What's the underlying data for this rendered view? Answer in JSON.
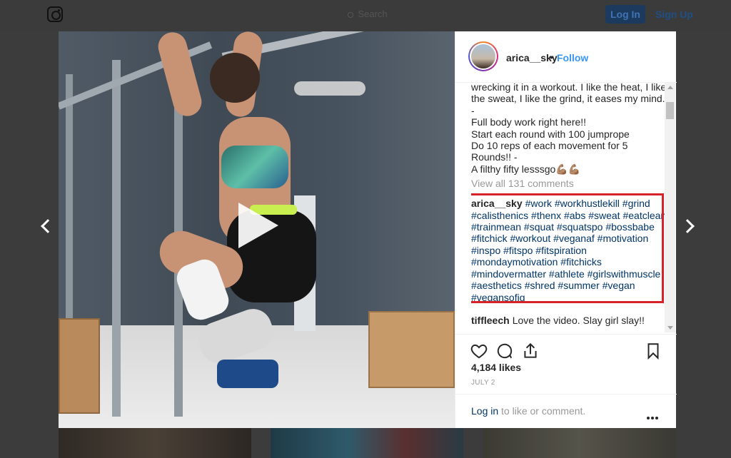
{
  "nav": {
    "search_placeholder": "Search",
    "login_label": "Log In",
    "signup_label": "Sign Up"
  },
  "post": {
    "username": "arica__sky",
    "separator": "•",
    "follow_label": "Follow",
    "caption_lines": "wrecking it in a workout. I like the heat, I like the sweat, I like the grind, it eases my mind.\n-\nFull body work right here!!\nStart each round with 100 jumprope\nDo 10 reps of each movement for 5 Rounds!! -\nA filthy fifty lesssgo💪🏽💪🏽",
    "view_all_comments": "View all 131 comments",
    "hashtag_comment": {
      "author": "arica__sky",
      "tags": "#work #workhustlekill #grind #calisthenics #thenx #abs #sweat #eatclean #trainmean #squat #squatspo #bossbabe #fitchick #workout #veganaf #motivation #inspo #fitspo #fitspiration #mondaymotivation #fitchicks #mindovermatter #athlete #girlswithmuscle #aesthetics #shred #summer #vegan #vegansofig"
    },
    "comment2": {
      "author": "tiffleech",
      "text": "Love the video. Slay girl slay!!"
    },
    "likes": "4,184 likes",
    "date": "JULY 2",
    "login_link": "Log in",
    "login_rest": "to like or comment."
  },
  "icons": {
    "heart": "heart-icon",
    "comment": "comment-icon",
    "share": "share-icon",
    "save": "bookmark-icon",
    "more": "more-options-icon",
    "play": "play-icon"
  },
  "colors": {
    "link": "#003569",
    "follow": "#3897f0",
    "highlight_border": "#d7222a",
    "login_button": "#1c3a5e"
  }
}
